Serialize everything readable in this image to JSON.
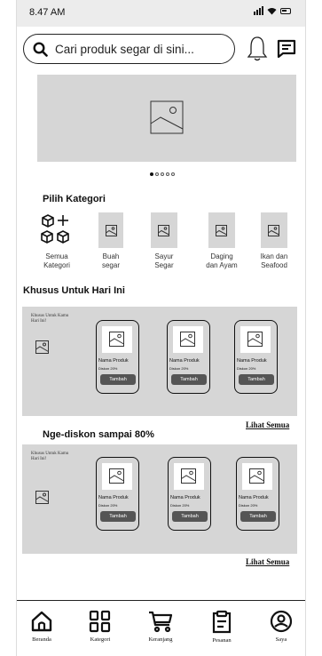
{
  "status": {
    "time": "8.47 AM"
  },
  "search": {
    "placeholder": "Cari produk segar di sini..."
  },
  "header_icons": [
    "search-icon",
    "bell-icon",
    "chat-icon"
  ],
  "carousel": {
    "pages": 5,
    "active": 1
  },
  "categories": {
    "title": "Pilih Kategori",
    "items": [
      {
        "label_line1": "Semua",
        "label_line2": "Kategori",
        "icon": "category-grid-add-icon"
      },
      {
        "label_line1": "Buah",
        "label_line2": "segar",
        "icon": "image-icon"
      },
      {
        "label_line1": "Sayur",
        "label_line2": "Segar",
        "icon": "image-icon"
      },
      {
        "label_line1": "Daging",
        "label_line2": "dan Ayam",
        "icon": "image-icon"
      },
      {
        "label_line1": "Ikan dan",
        "label_line2": "Seafood",
        "icon": "image-icon"
      }
    ]
  },
  "today_special": {
    "title": "Khusus Untuk Hari Ini",
    "banner_text": "Khusus Untuk Kamu Hari Ini!",
    "see_all": "Lihat Semua",
    "products": [
      {
        "name": "Nama Produk",
        "discount": "Diskon 20%",
        "button": "Tambah"
      },
      {
        "name": "Nama Produk",
        "discount": "Diskon 20%",
        "button": "Tambah"
      },
      {
        "name": "Nama Produk",
        "discount": "Diskon 20%",
        "button": "Tambah"
      }
    ]
  },
  "discount_section": {
    "title": "Nge-diskon sampai 80%",
    "banner_text": "Khusus Untuk Kamu Hari Ini!",
    "see_all": "Lihat Semua",
    "products": [
      {
        "name": "Nama Produk",
        "discount": "Diskon 20%",
        "button": "Tambah"
      },
      {
        "name": "Nama Produk",
        "discount": "Diskon 20%",
        "button": "Tambah"
      },
      {
        "name": "Nama Produk",
        "discount": "Diskon 20%",
        "button": "Tambah"
      }
    ]
  },
  "bottom_nav": [
    {
      "label": "Beranda",
      "icon": "home-icon"
    },
    {
      "label": "Kategori",
      "icon": "grid-icon"
    },
    {
      "label": "Keranjang",
      "icon": "cart-icon"
    },
    {
      "label": "Pesanan",
      "icon": "clipboard-icon"
    },
    {
      "label": "Saya",
      "icon": "user-icon"
    }
  ],
  "colors": {
    "placeholder_gray": "#d6d6d6",
    "button_dark": "#555555",
    "ink": "#111111"
  }
}
